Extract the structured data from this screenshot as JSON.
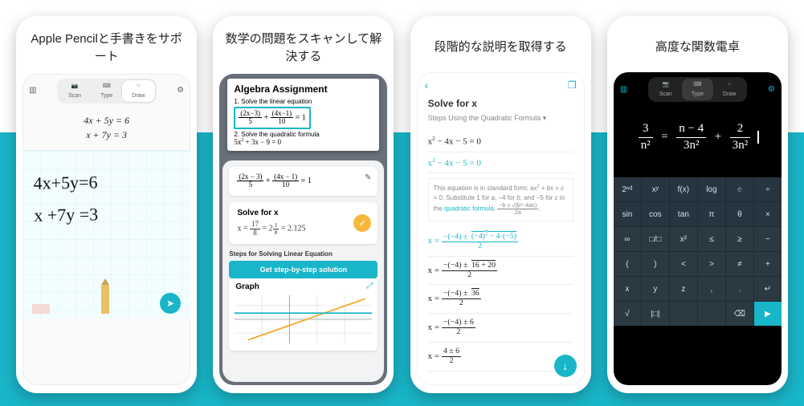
{
  "cards": [
    {
      "title": "Apple Pencilと手書きをサポート"
    },
    {
      "title": "数学の問題をスキャンして解決する"
    },
    {
      "title": "段階的な説明を取得する"
    },
    {
      "title": "高度な関数電卓"
    }
  ],
  "draw": {
    "modes": {
      "scan": "Scan",
      "type": "Type",
      "draw": "Draw"
    },
    "printed_eq1": "4x + 5y = 6",
    "printed_eq2": "x + 7y = 3",
    "hand_eq1": "4x+5y=6",
    "hand_eq2": "x +7y =3"
  },
  "scan": {
    "doc_title": "Algebra Assignment",
    "q1_label": "1. Solve the linear equation",
    "q1_eq": "(2x−3)/5 + (4x−1)/10 = 1",
    "q2_label": "2. Solve the quadratic formula",
    "q2_eq": "5x² + 3x − 9 = 0",
    "panel_eq": "(2x − 3)/5 + (4x − 1)/10 = 1",
    "solve_heading": "Solve for x",
    "solve_value": "x = 17/8 = 2 1/8 = 2.125",
    "steps_label": "Steps for Solving Linear Equation",
    "cta": "Get step-by-step solution",
    "graph_label": "Graph"
  },
  "steps": {
    "heading": "Solve for x",
    "subhead": "Steps Using the Quadratic Formula  ▾",
    "eq_main": "x² − 4x − 5 = 0",
    "explain_text": "This equation is in standard form: ax² + bx + c = 0. Substitute 1 for a, −4 for b, and −5 for c in the quadratic formula, (−b ± √(b²−4ac)) / 2a.",
    "quadratic_link": "quadratic formula",
    "step_a": "x = (−(−4) ± √((−4)² − 4·(−5))) / 2",
    "step_b": "x = (−(−4) ± √(16 + 20)) / 2",
    "step_c": "x = (−(−4) ± √36) / 2",
    "step_d": "x = (−(−4) ± 6) / 2",
    "step_e": "x = (4 ± 6) / 2"
  },
  "calc": {
    "modes": {
      "scan": "Scan",
      "type": "Type",
      "draw": "Draw"
    },
    "display_lhs_num": "3",
    "display_lhs_den": "n²",
    "display_mid_num": "n − 4",
    "display_mid_den": "3n²",
    "display_rhs_num": "2",
    "display_rhs_den": "3n²",
    "keys_row1": [
      "2ⁿᵈ",
      "xʸ",
      "f(x)",
      "log",
      "e",
      "÷"
    ],
    "keys_row2": [
      "sin",
      "cos",
      "tan",
      "π",
      "θ",
      "×"
    ],
    "keys_row3": [
      "∞",
      "□/□",
      "x²",
      "≤",
      "≥",
      "−"
    ],
    "keys_row4": [
      "(",
      ")",
      "<",
      ">",
      "≠",
      "+"
    ],
    "keys_row5": [
      "x",
      "y",
      "z",
      ",",
      ".",
      "↵"
    ],
    "keys_row6": [
      "√",
      "|□|",
      "",
      "",
      "⌫",
      "▶"
    ]
  }
}
